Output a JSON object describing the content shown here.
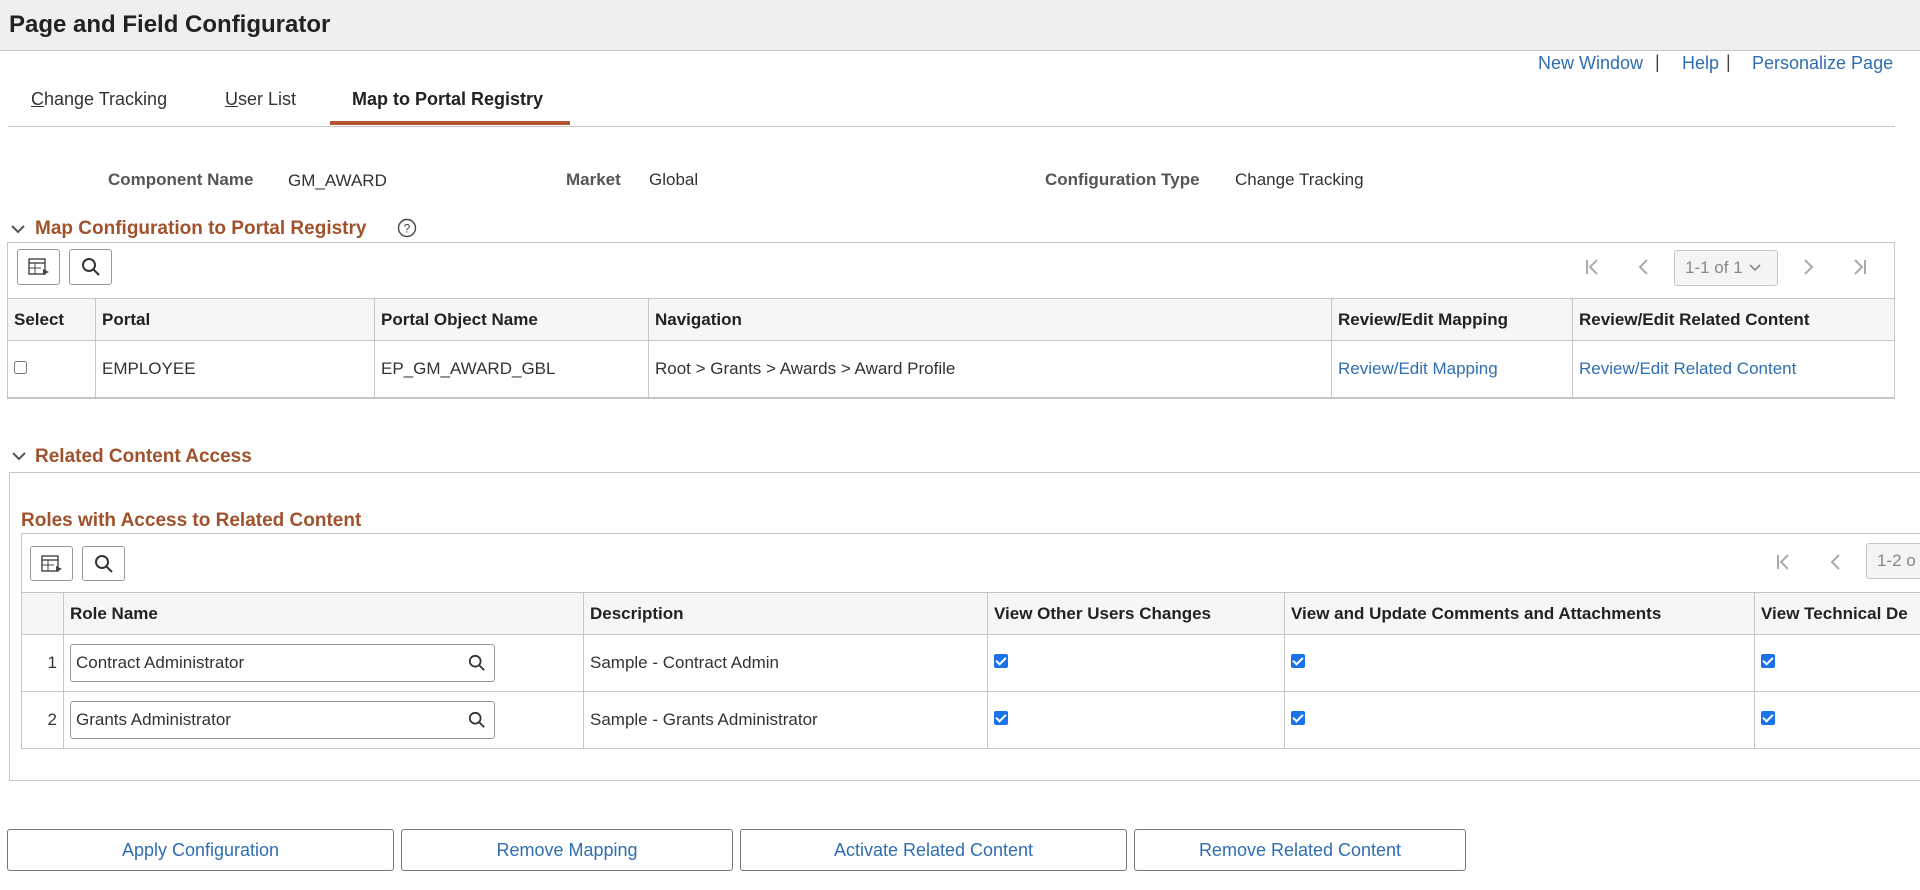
{
  "page": {
    "title": "Page and Field Configurator"
  },
  "toplinks": {
    "new_window": "New Window",
    "help": "Help",
    "personalize": "Personalize Page",
    "separator": "|"
  },
  "tabs": [
    {
      "label": "Change Tracking",
      "accesskey": "C"
    },
    {
      "label": "User List",
      "accesskey": "U"
    },
    {
      "label": "Map to Portal Registry",
      "active": true
    }
  ],
  "header": {
    "component_label": "Component Name",
    "component_value": "GM_AWARD",
    "market_label": "Market",
    "market_value": "Global",
    "config_type_label": "Configuration Type",
    "config_type_value": "Change Tracking"
  },
  "map_section": {
    "title": "Map Configuration to Portal Registry",
    "pager": "1-1 of 1",
    "columns": [
      "Select",
      "Portal",
      "Portal Object Name",
      "Navigation",
      "Review/Edit Mapping",
      "Review/Edit Related Content"
    ],
    "rows": [
      {
        "selected": false,
        "portal": "EMPLOYEE",
        "object_name": "EP_GM_AWARD_GBL",
        "navigation": "Root > Grants > Awards > Award Profile",
        "mapping_link": "Review/Edit Mapping",
        "related_link": "Review/Edit Related Content"
      }
    ]
  },
  "related_section": {
    "title": "Related Content Access",
    "sub_title": "Roles with Access to Related Content",
    "pager": "1-2 o",
    "columns": [
      "Role Name",
      "Description",
      "View Other Users Changes",
      "View and Update Comments and Attachments",
      "View Technical De"
    ],
    "rows": [
      {
        "num": "1",
        "role": "Contract Administrator",
        "description": "Sample - Contract Admin",
        "view_other": true,
        "comments": true,
        "technical": true
      },
      {
        "num": "2",
        "role": "Grants Administrator",
        "description": "Sample - Grants Administrator",
        "view_other": true,
        "comments": true,
        "technical": true
      }
    ]
  },
  "buttons": {
    "apply": "Apply Configuration",
    "remove_mapping": "Remove Mapping",
    "activate_related": "Activate Related Content",
    "remove_related": "Remove Related Content"
  },
  "colors": {
    "accent": "#b2562d",
    "link": "#2f6eb0",
    "section": "#a0522d",
    "checkbox": "#1a73e8"
  }
}
